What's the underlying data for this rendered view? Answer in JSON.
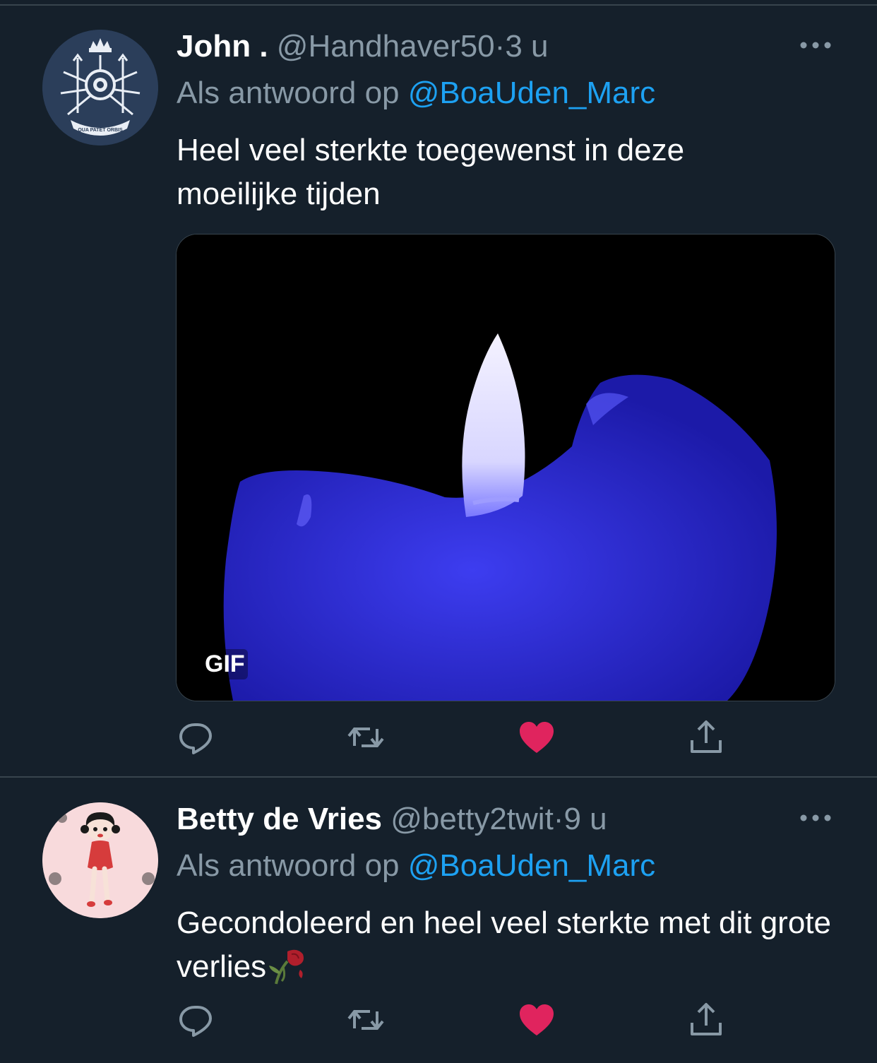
{
  "tweets": [
    {
      "name": "John .",
      "handle": "@Handhaver50",
      "dot": "·",
      "time": "3 u",
      "reply_prefix": "Als antwoord op",
      "reply_mention": "@BoaUden_Marc",
      "text": "Heel veel sterkte toegewenst in deze moeilijke tijden",
      "media_badge": "GIF",
      "avatar_icon": "coat-of-arms-icon",
      "avatar_motto": "QUA PATET ORBIS",
      "liked": true
    },
    {
      "name": "Betty de Vries",
      "handle": "@betty2twit",
      "dot": "·",
      "time": "9 u",
      "reply_prefix": "Als antwoord op",
      "reply_mention": "@BoaUden_Marc",
      "text": "Gecondoleerd en heel veel sterkte met dit grote verlies",
      "text_emoji": "wilted-rose-icon",
      "avatar_icon": "betty-boop-avatar",
      "liked": true
    }
  ],
  "colors": {
    "background": "#15202b",
    "secondary_text": "#8899a6",
    "mention": "#1da1f2",
    "like": "#e0245e",
    "divider": "#38444d"
  },
  "action_icons": [
    "reply-icon",
    "retweet-icon",
    "like-icon",
    "share-icon"
  ]
}
